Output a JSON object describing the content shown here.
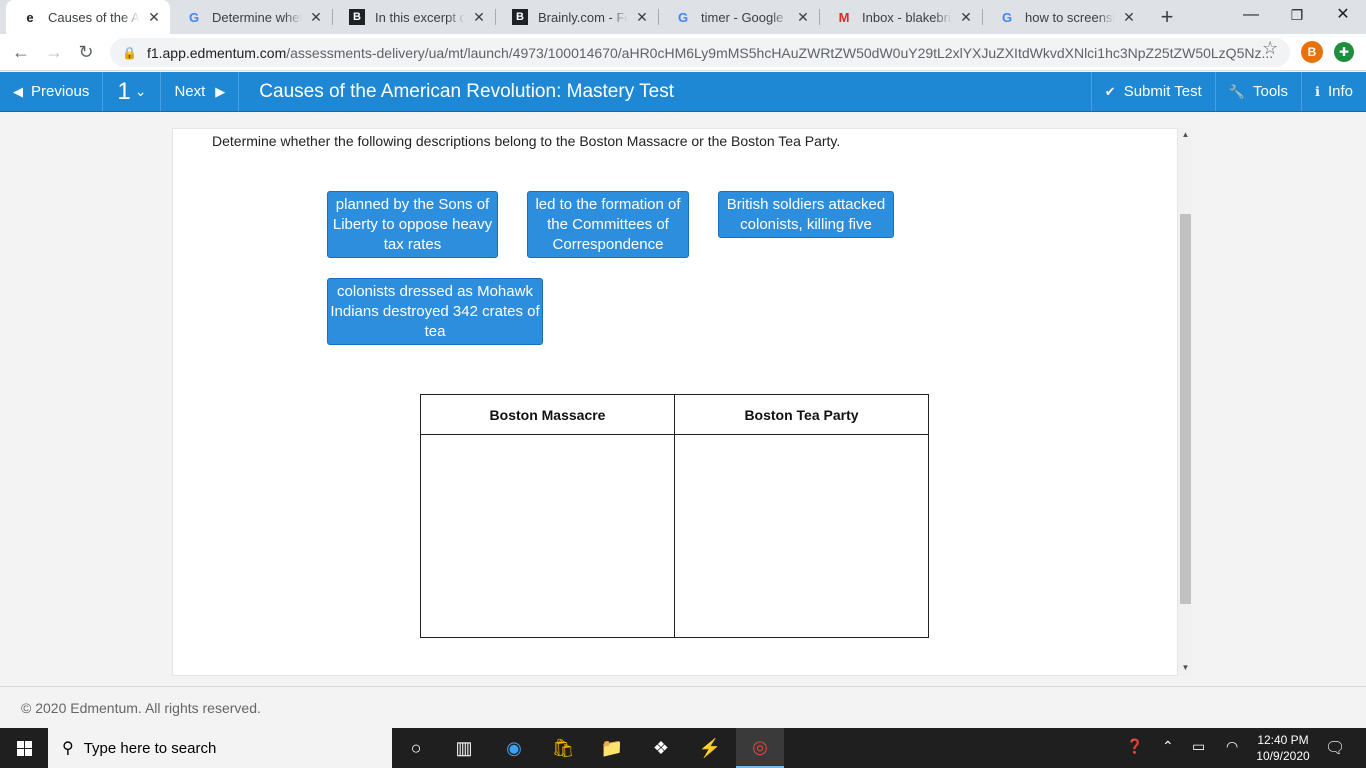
{
  "browser": {
    "tabs": [
      {
        "title": "Causes of the American Revolution: Mastery Test",
        "favicon": "edmentum-icon",
        "active": true
      },
      {
        "title": "Determine whether the following",
        "favicon": "google-icon"
      },
      {
        "title": "In this excerpt of The",
        "favicon": "brainly-icon"
      },
      {
        "title": "Brainly.com - For students",
        "favicon": "brainly-icon"
      },
      {
        "title": "timer - Google Search",
        "favicon": "google-icon"
      },
      {
        "title": "Inbox - blakebrinson",
        "favicon": "gmail-icon"
      },
      {
        "title": "how to screenshot",
        "favicon": "google-icon"
      }
    ],
    "url_host": "f1.app.edmentum.com",
    "url_path": "/assessments-delivery/ua/mt/launch/4973/100014670/aHR0cHM6Ly9mMS5hcHAuZWRtZW50dW0uY29tL2xlYXJuZXItdWkvdXNlci1hc3NpZ25tZW50LzQ5Nz...",
    "profile_initial": "B"
  },
  "appbar": {
    "previous_label": "Previous",
    "question_number": "1",
    "next_label": "Next",
    "title": "Causes of the American Revolution: Mastery Test",
    "submit_label": "Submit Test",
    "tools_label": "Tools",
    "info_label": "Info"
  },
  "question": {
    "instructions": "Determine whether the following descriptions belong to the Boston Massacre or the Boston Tea Party.",
    "chips": [
      "planned by the Sons of Liberty to oppose heavy tax rates",
      "led to the formation of the Committees of Correspondence",
      "British soldiers attacked colonists, killing five",
      "colonists dressed as Mohawk Indians destroyed 342 crates of tea"
    ],
    "columns": [
      "Boston Massacre",
      "Boston Tea Party"
    ]
  },
  "footer": {
    "copyright": "© 2020 Edmentum. All rights reserved."
  },
  "taskbar": {
    "search_placeholder": "Type here to search",
    "time": "12:40 PM",
    "date": "10/9/2020"
  },
  "colors": {
    "appbar": "#1e88d4",
    "chip": "#2e8ede"
  }
}
